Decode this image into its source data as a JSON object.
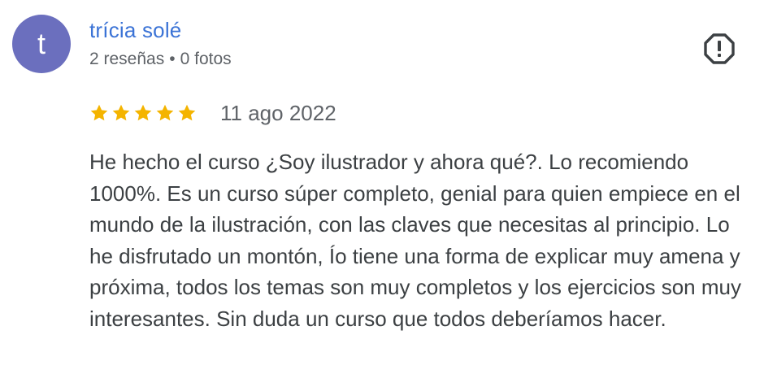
{
  "author": {
    "avatar_letter": "t",
    "avatar_color": "#6b6fbe",
    "name": "trícia solé",
    "name_color": "#3b73d6",
    "reviews": "2 reseñas",
    "separator": "•",
    "photos": "0 fotos"
  },
  "report": {
    "icon": "report-flag-icon"
  },
  "rating": {
    "stars": 5,
    "max": 5,
    "star_color": "#f4b400",
    "date": "11 ago 2022"
  },
  "review": {
    "text": "He hecho el curso ¿Soy ilustrador y ahora qué?. Lo recomiendo 1000%. Es un curso súper completo, genial para quien empiece en el mundo de la ilustración, con las claves que necesitas al principio. Lo he disfrutado un montón, Ío tiene una forma de explicar muy amena y próxima, todos los temas son muy completos y los ejercicios son muy interesantes. Sin duda un curso que todos deberíamos hacer."
  }
}
